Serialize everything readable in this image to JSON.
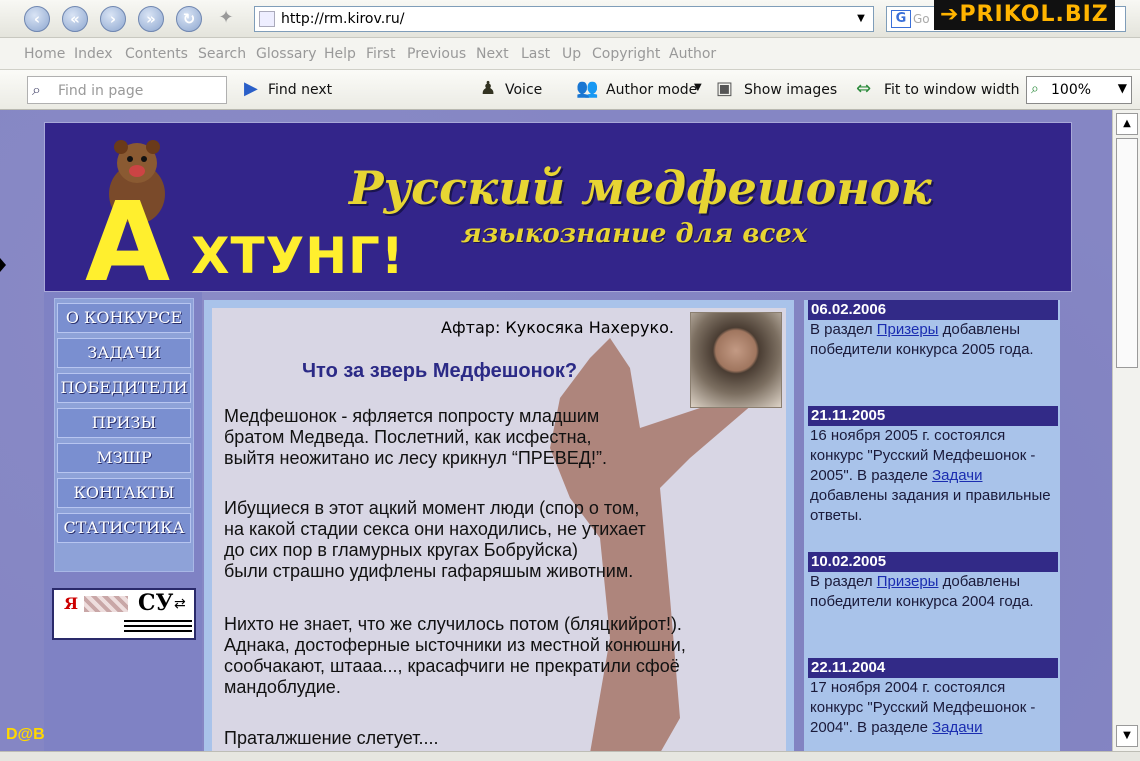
{
  "browser": {
    "address_url": "http://rm.kirov.ru/",
    "search_placeholder": "Go",
    "watermark": "PRIKOL.BIZ",
    "menu_row": [
      "Home",
      "Index",
      "Contents",
      "Search",
      "Glossary",
      "Help",
      "First",
      "Previous",
      "Next",
      "Last",
      "Up",
      "Copyright",
      "Author"
    ],
    "find_placeholder": "Find in page",
    "find_next": "Find next",
    "voice": "Voice",
    "author_mode": "Author mode",
    "show_images": "Show images",
    "fit_width": "Fit to window width",
    "zoom": "100%"
  },
  "banner": {
    "ahtung_a": "А",
    "ahtung_rest": "ХТУНГ!",
    "title": "Русский медфешонок",
    "subtitle": "языкознание для всех"
  },
  "nav": {
    "items": [
      "О КОНКУРСЕ",
      "ЗАДАЧИ",
      "ПОБЕДИТЕЛИ",
      "ПРИЗЫ",
      "МЗШР",
      "КОНТАКТЫ",
      "СТАТИСТИКА"
    ]
  },
  "counter": {
    "letter": "Я",
    "brand": "СУ",
    "arrows": "⇄"
  },
  "article": {
    "author": "Афтар: Кукосяка Нахеруко.",
    "title": "Что за зверь Медфешонок?",
    "paragraphs": [
      "Медфешонок - яфляется попросту младшим\nбратом Медведа. Послетний, как исфестна,\nвыйтя неожитано ис лесу крикнул “ПРЕВЕД!”.",
      "Ибущиеся в этот ацкий момент люди (спор о том,\nна какой стадии секса они находились, не утихает\nдо сих пор в гламурных кругах Бобруйска)\nбыли страшно удифлены гафаряшым животним.",
      "Нихто не знает, что же случилось потом (бляцкийрот!).\nАднака, достоферные ысточники  из местной конюшни,\nсообчакают, штааа..., красафчиги не прекратили сфоё\nмандоблудие.",
      "Праталжшение слетует...."
    ]
  },
  "news": [
    {
      "date": "06.02.2006",
      "pre": "В раздел ",
      "link": "Призеры",
      "post": " добавлены победители конкурса 2005 года."
    },
    {
      "date": "21.11.2005",
      "pre": "16 ноября 2005 г. состоялся конкурс \"Русский Медфешонок - 2005\". В разделе ",
      "link": "Задачи",
      "post": " добавлены задания и правильные ответы."
    },
    {
      "date": "10.02.2005",
      "pre": "В раздел ",
      "link": "Призеры",
      "post": " добавлены победители конкурса 2004 года."
    },
    {
      "date": "22.11.2004",
      "pre": "17 ноября 2004 г. состоялся конкурс \"Русский Медфешонок - 2004\". В разделе ",
      "link": "Задачи",
      "post": ""
    }
  ],
  "signature": "D@B",
  "colors": {
    "banner": "#33258a",
    "page_bg": "#8586c4",
    "accent_yellow": "#ffef2e",
    "title_blue": "#2b2a86"
  }
}
